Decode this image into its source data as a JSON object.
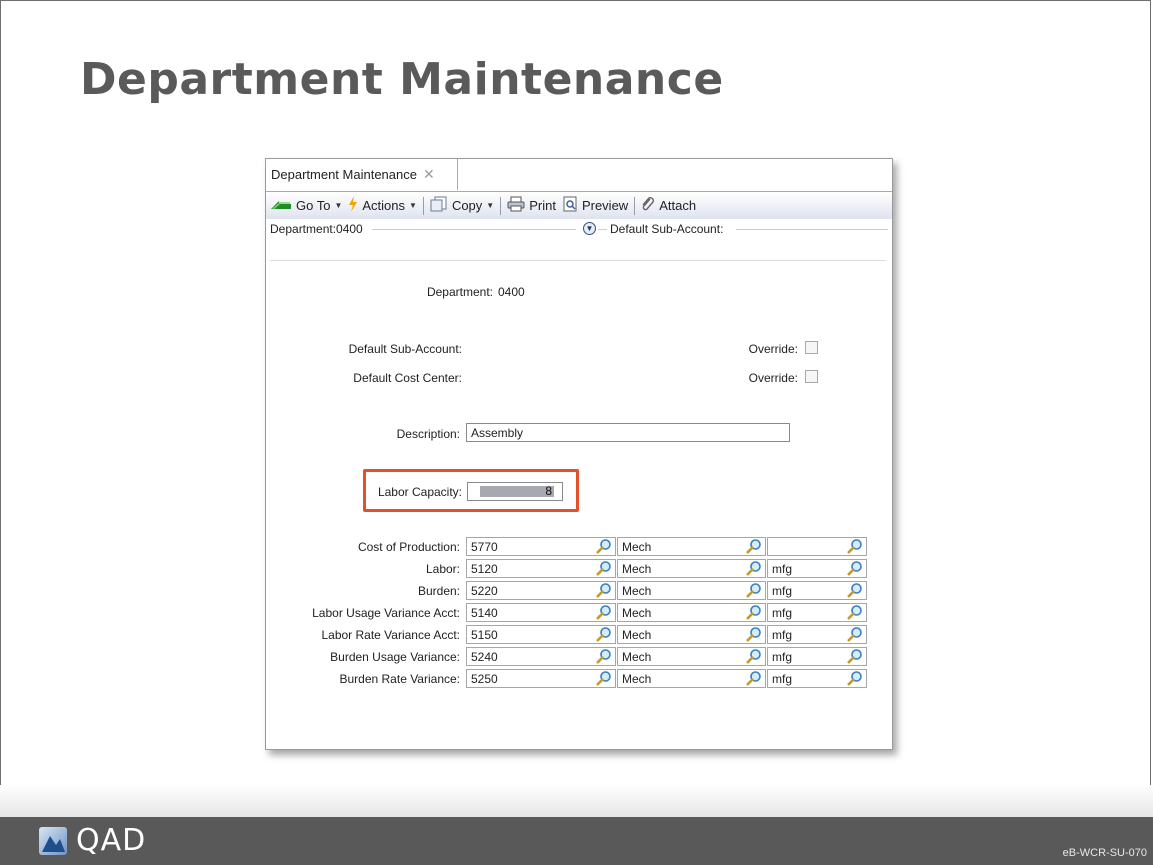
{
  "slide": {
    "title": "Department Maintenance",
    "footer_code": "eB-WCR-SU-070",
    "logo_text": "QAD"
  },
  "window": {
    "tab_label": "Department Maintenance",
    "tab_close": "✕"
  },
  "toolbar": {
    "goto_label": "Go To",
    "actions_label": "Actions",
    "copy_label": "Copy",
    "print_label": "Print",
    "preview_label": "Preview",
    "attach_label": "Attach"
  },
  "summary": {
    "department": "Department:0400",
    "default_subaccount": "Default Sub-Account:"
  },
  "form": {
    "department_label": "Department:",
    "department_value": "0400",
    "default_subaccount_label": "Default Sub-Account:",
    "default_cost_center_label": "Default Cost Center:",
    "override_label": "Override:",
    "override_subaccount_checked": false,
    "override_cost_center_checked": false,
    "description_label": "Description:",
    "description_value": "Assembly",
    "labor_capacity_label": "Labor Capacity:",
    "labor_capacity_value": "8"
  },
  "accounts": [
    {
      "label": "Cost of Production:",
      "account": "5770",
      "subaccount": "Mech",
      "cost_center": ""
    },
    {
      "label": "Labor:",
      "account": "5120",
      "subaccount": "Mech",
      "cost_center": "mfg"
    },
    {
      "label": "Burden:",
      "account": "5220",
      "subaccount": "Mech",
      "cost_center": "mfg"
    },
    {
      "label": "Labor Usage Variance Acct:",
      "account": "5140",
      "subaccount": "Mech",
      "cost_center": "mfg"
    },
    {
      "label": "Labor Rate Variance Acct:",
      "account": "5150",
      "subaccount": "Mech",
      "cost_center": "mfg"
    },
    {
      "label": "Burden Usage Variance:",
      "account": "5240",
      "subaccount": "Mech",
      "cost_center": "mfg"
    },
    {
      "label": "Burden Rate Variance:",
      "account": "5250",
      "subaccount": "Mech",
      "cost_center": "mfg"
    }
  ],
  "colors": {
    "highlight": "#e2502c",
    "footer": "#595959",
    "title": "#5a5a5a"
  },
  "icons": {
    "lookup": "magnifier-icon",
    "goto": "green-arrow-icon",
    "actions": "lightning-icon",
    "copy": "copy-icon",
    "print": "printer-icon",
    "preview": "preview-icon",
    "attach": "paperclip-icon",
    "expand": "chevron-down-circle-icon"
  }
}
